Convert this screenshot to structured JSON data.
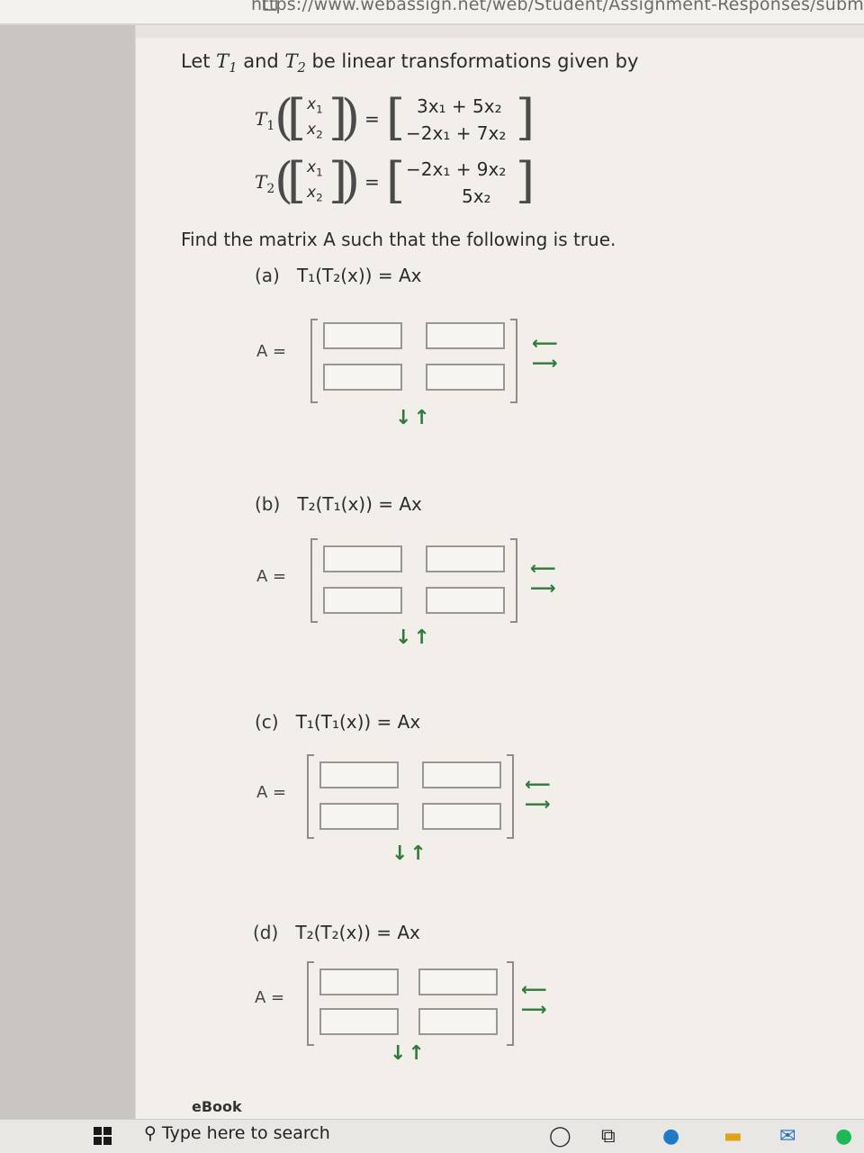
{
  "browser": {
    "url": "https://www.webassign.net/web/Student/Assignment-Responses/subm"
  },
  "problem": {
    "intro_let": "Let",
    "intro_and": "and",
    "intro_rest": "be linear transformations given by",
    "t1_row1": "3x₁ + 5x₂",
    "t1_row2": "−2x₁ + 7x₂",
    "t2_row1": "−2x₁ + 9x₂",
    "t2_row2": "5x₂",
    "find_text": "Find the matrix A such that the following is true."
  },
  "parts": [
    {
      "label": "(a)",
      "equation": "T₁(T₂(x)) = Ax"
    },
    {
      "label": "(b)",
      "equation": "T₂(T₁(x)) = Ax"
    },
    {
      "label": "(c)",
      "equation": "T₁(T₁(x)) = Ax"
    },
    {
      "label": "(d)",
      "equation": "T₂(T₂(x)) = Ax"
    }
  ],
  "a_equals": "A =",
  "ebook_label": "eBook",
  "taskbar": {
    "search_placeholder": "Type here to search"
  },
  "colors": {
    "arrow": "#2f7a3a",
    "page_bg": "#f2efeb"
  }
}
